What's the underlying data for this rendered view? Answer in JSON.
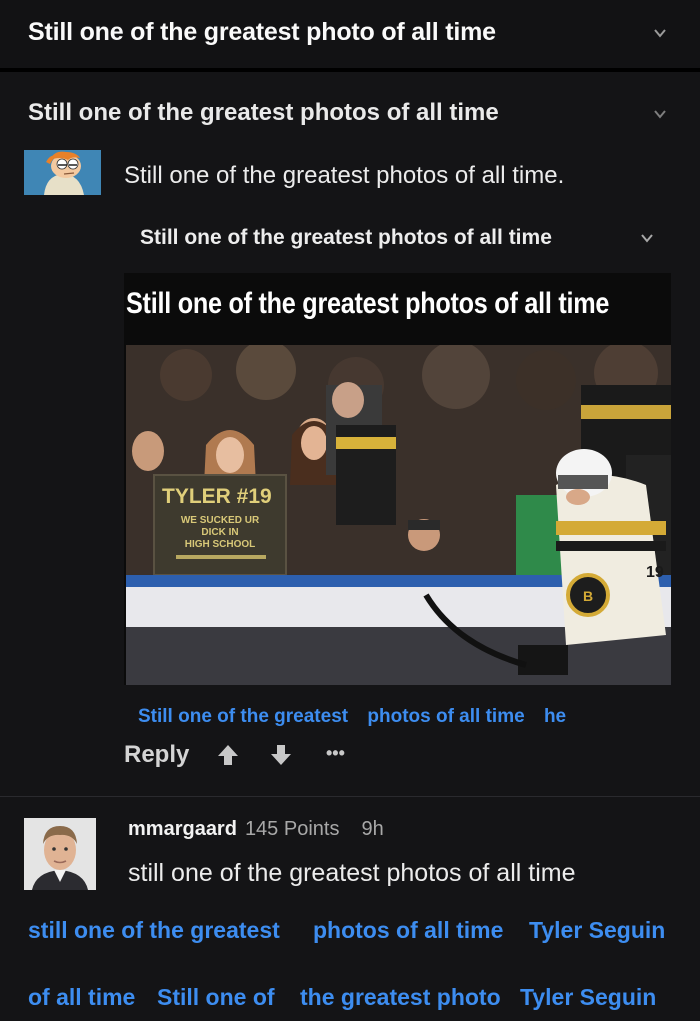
{
  "header": {
    "title": "Still one of the greatest photo of all time"
  },
  "post": {
    "title": "Still one of the greatest photos of all time"
  },
  "comment1": {
    "text": "Still one of the greatest photos of all time."
  },
  "comment2": {
    "title": "Still one of the greatest photos of all time"
  },
  "photo": {
    "title": "Still one of the greatest photos of all time",
    "sign_line1": "TYLER #19",
    "sign_line2": "WE SUCKED UR",
    "sign_line3": "DICK IN",
    "sign_line4": "HIGH SCHOOL",
    "jersey_number": "19"
  },
  "links_row1": [
    "Still one of the greatest",
    "photos of all time",
    "he"
  ],
  "actions": {
    "reply_label": "Reply",
    "more_label": "•••"
  },
  "comment3": {
    "username": "mmargaard",
    "points": "145 Points",
    "time": "9h",
    "text": "still one of the greatest photos of all time"
  },
  "links_row2": [
    "still one of the greatest",
    "photos of all time",
    "Tyler Seguin"
  ],
  "links_row3": [
    "of all time",
    "Still one of",
    "the greatest photo",
    "Tyler Seguin"
  ],
  "colors": {
    "link": "#3d8df0",
    "background": "#141416"
  }
}
